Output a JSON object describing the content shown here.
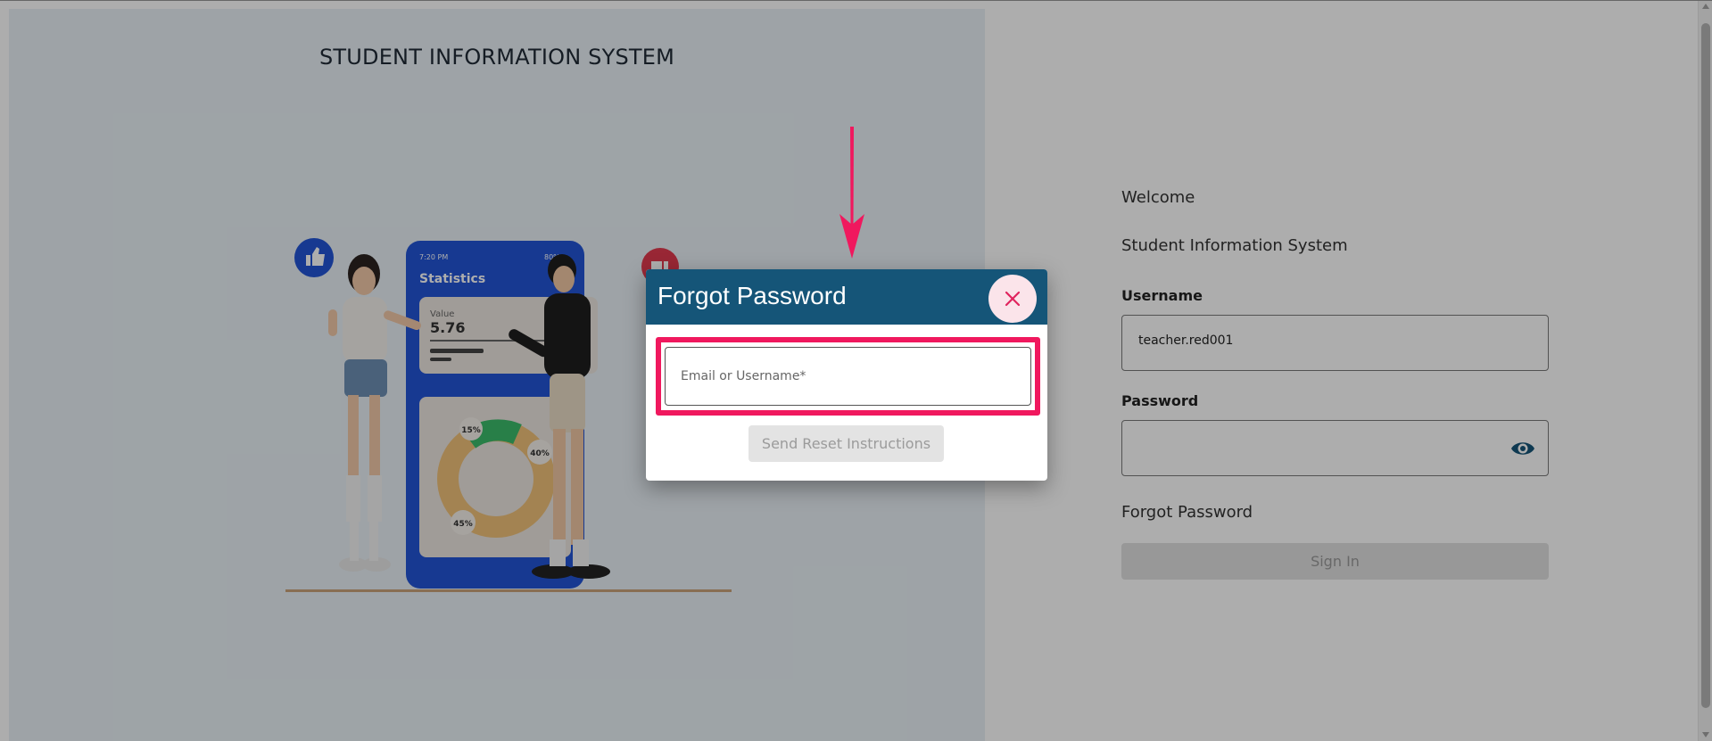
{
  "app": {
    "title": "STUDENT INFORMATION SYSTEM"
  },
  "illustration": {
    "phone_time": "7:20 PM",
    "phone_battery": "80%",
    "phone_header": "Statistics",
    "value_label": "Value",
    "value_number": "5.76",
    "donut_labels": [
      "15%",
      "40%",
      "45%"
    ]
  },
  "login": {
    "welcome": "Welcome",
    "subtitle": "Student Information System",
    "username_label": "Username",
    "username_value": "teacher.red001",
    "password_label": "Password",
    "forgot_link": "Forgot Password",
    "signin_label": "Sign In"
  },
  "dialog": {
    "title": "Forgot Password",
    "email_placeholder": "Email or Username*",
    "send_label": "Send Reset Instructions"
  },
  "colors": {
    "dialog_header": "#155578",
    "highlight": "#f0185e",
    "arrow": "#f0185e",
    "close_bg": "#fbe4ea",
    "close_icon": "#e0245e",
    "eye_icon": "#155578",
    "phone_blue": "#2255d6"
  },
  "icons": {
    "close": "close-icon",
    "eye": "eye-icon",
    "thumbs_up": "thumbs-up-icon",
    "thumbs_down": "thumbs-down-icon",
    "arrow": "arrow-down-icon"
  }
}
